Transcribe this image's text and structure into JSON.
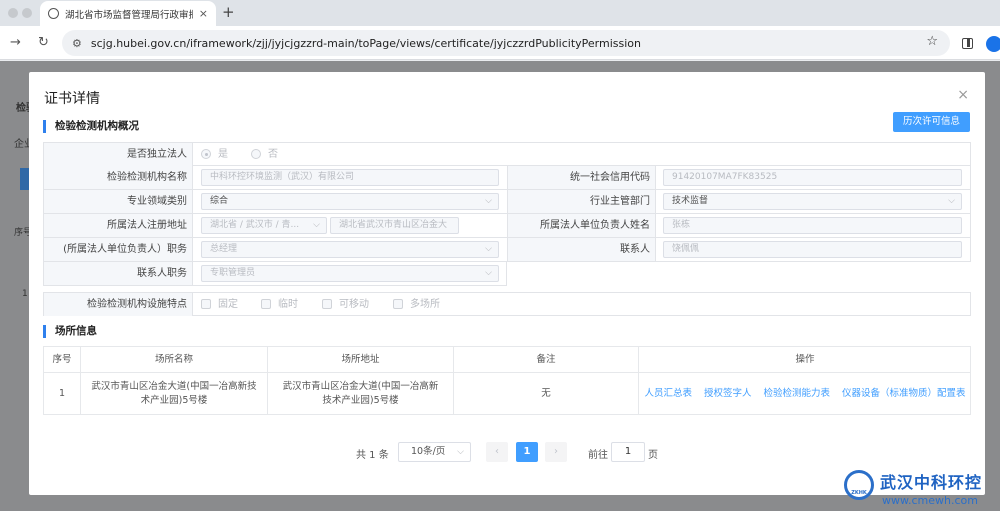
{
  "browser": {
    "tab_title": "湖北省市场监督管理局行政审批",
    "tab_close": "×",
    "new_tab": "+",
    "url": "scjg.hubei.gov.cn/iframework/zjj/jyjcjgzzrd-main/toPage/views/certificate/jyjczzrdPublicityPermission"
  },
  "page_bg": {
    "frag1": "检验",
    "frag2": "企业",
    "frag3": "序号",
    "frag4": "1"
  },
  "modal": {
    "title": "证书详情",
    "close": "×",
    "section1_title": "检验检测机构概况",
    "history_button": "历次许可信息",
    "fields": {
      "independent_label": "是否独立法人",
      "independent_yes": "是",
      "independent_no": "否",
      "org_name_label": "检验检测机构名称",
      "org_name": "中科环控环境监测（武汉）有限公司",
      "credit_code_label": "统一社会信用代码",
      "credit_code": "91420107MA7FK83525",
      "field_type_label": "专业领域类别",
      "field_type": "综合",
      "dept_label": "行业主管部门",
      "dept": "技术监督",
      "address_label": "所属法人注册地址",
      "region": "湖北省 / 武汉市 / 青...",
      "address": "湖北省武汉市青山区冶金大",
      "rep_name_label": "所属法人单位负责人姓名",
      "rep_name": "张栋",
      "rep_title_label": "(所属法人单位负责人）职务",
      "rep_title": "总经理",
      "contact_label": "联系人",
      "contact": "饶佩佩",
      "contact_title_label": "联系人职务",
      "contact_title": "专职管理员",
      "facility_label": "检验检测机构设施特点",
      "facility_options": [
        "固定",
        "临时",
        "可移动",
        "多场所"
      ]
    },
    "section2_title": "场所信息",
    "table": {
      "headers": [
        "序号",
        "场所名称",
        "场所地址",
        "备注",
        "操作"
      ],
      "rows": [
        {
          "index": "1",
          "name": "武汉市青山区冶金大道(中国一冶高新技术产业园)5号楼",
          "address": "武汉市青山区冶金大道(中国一冶高新技术产业园)5号楼",
          "note": "无",
          "actions": [
            "人员汇总表",
            "授权签字人",
            "检验检测能力表",
            "仪器设备（标准物质）配置表"
          ]
        }
      ]
    },
    "pagination": {
      "total": "共 1 条",
      "page_size": "10条/页",
      "prev": "‹",
      "current": "1",
      "next": "›",
      "goto_label": "前往",
      "goto_value": "1",
      "goto_unit": "页"
    }
  },
  "watermark": {
    "logo_text": "ZKHK",
    "name": "武汉中科环控",
    "url": "www.cmewh.com"
  },
  "colors": {
    "primary": "#409eff",
    "section_bar": "#2f80ed"
  }
}
